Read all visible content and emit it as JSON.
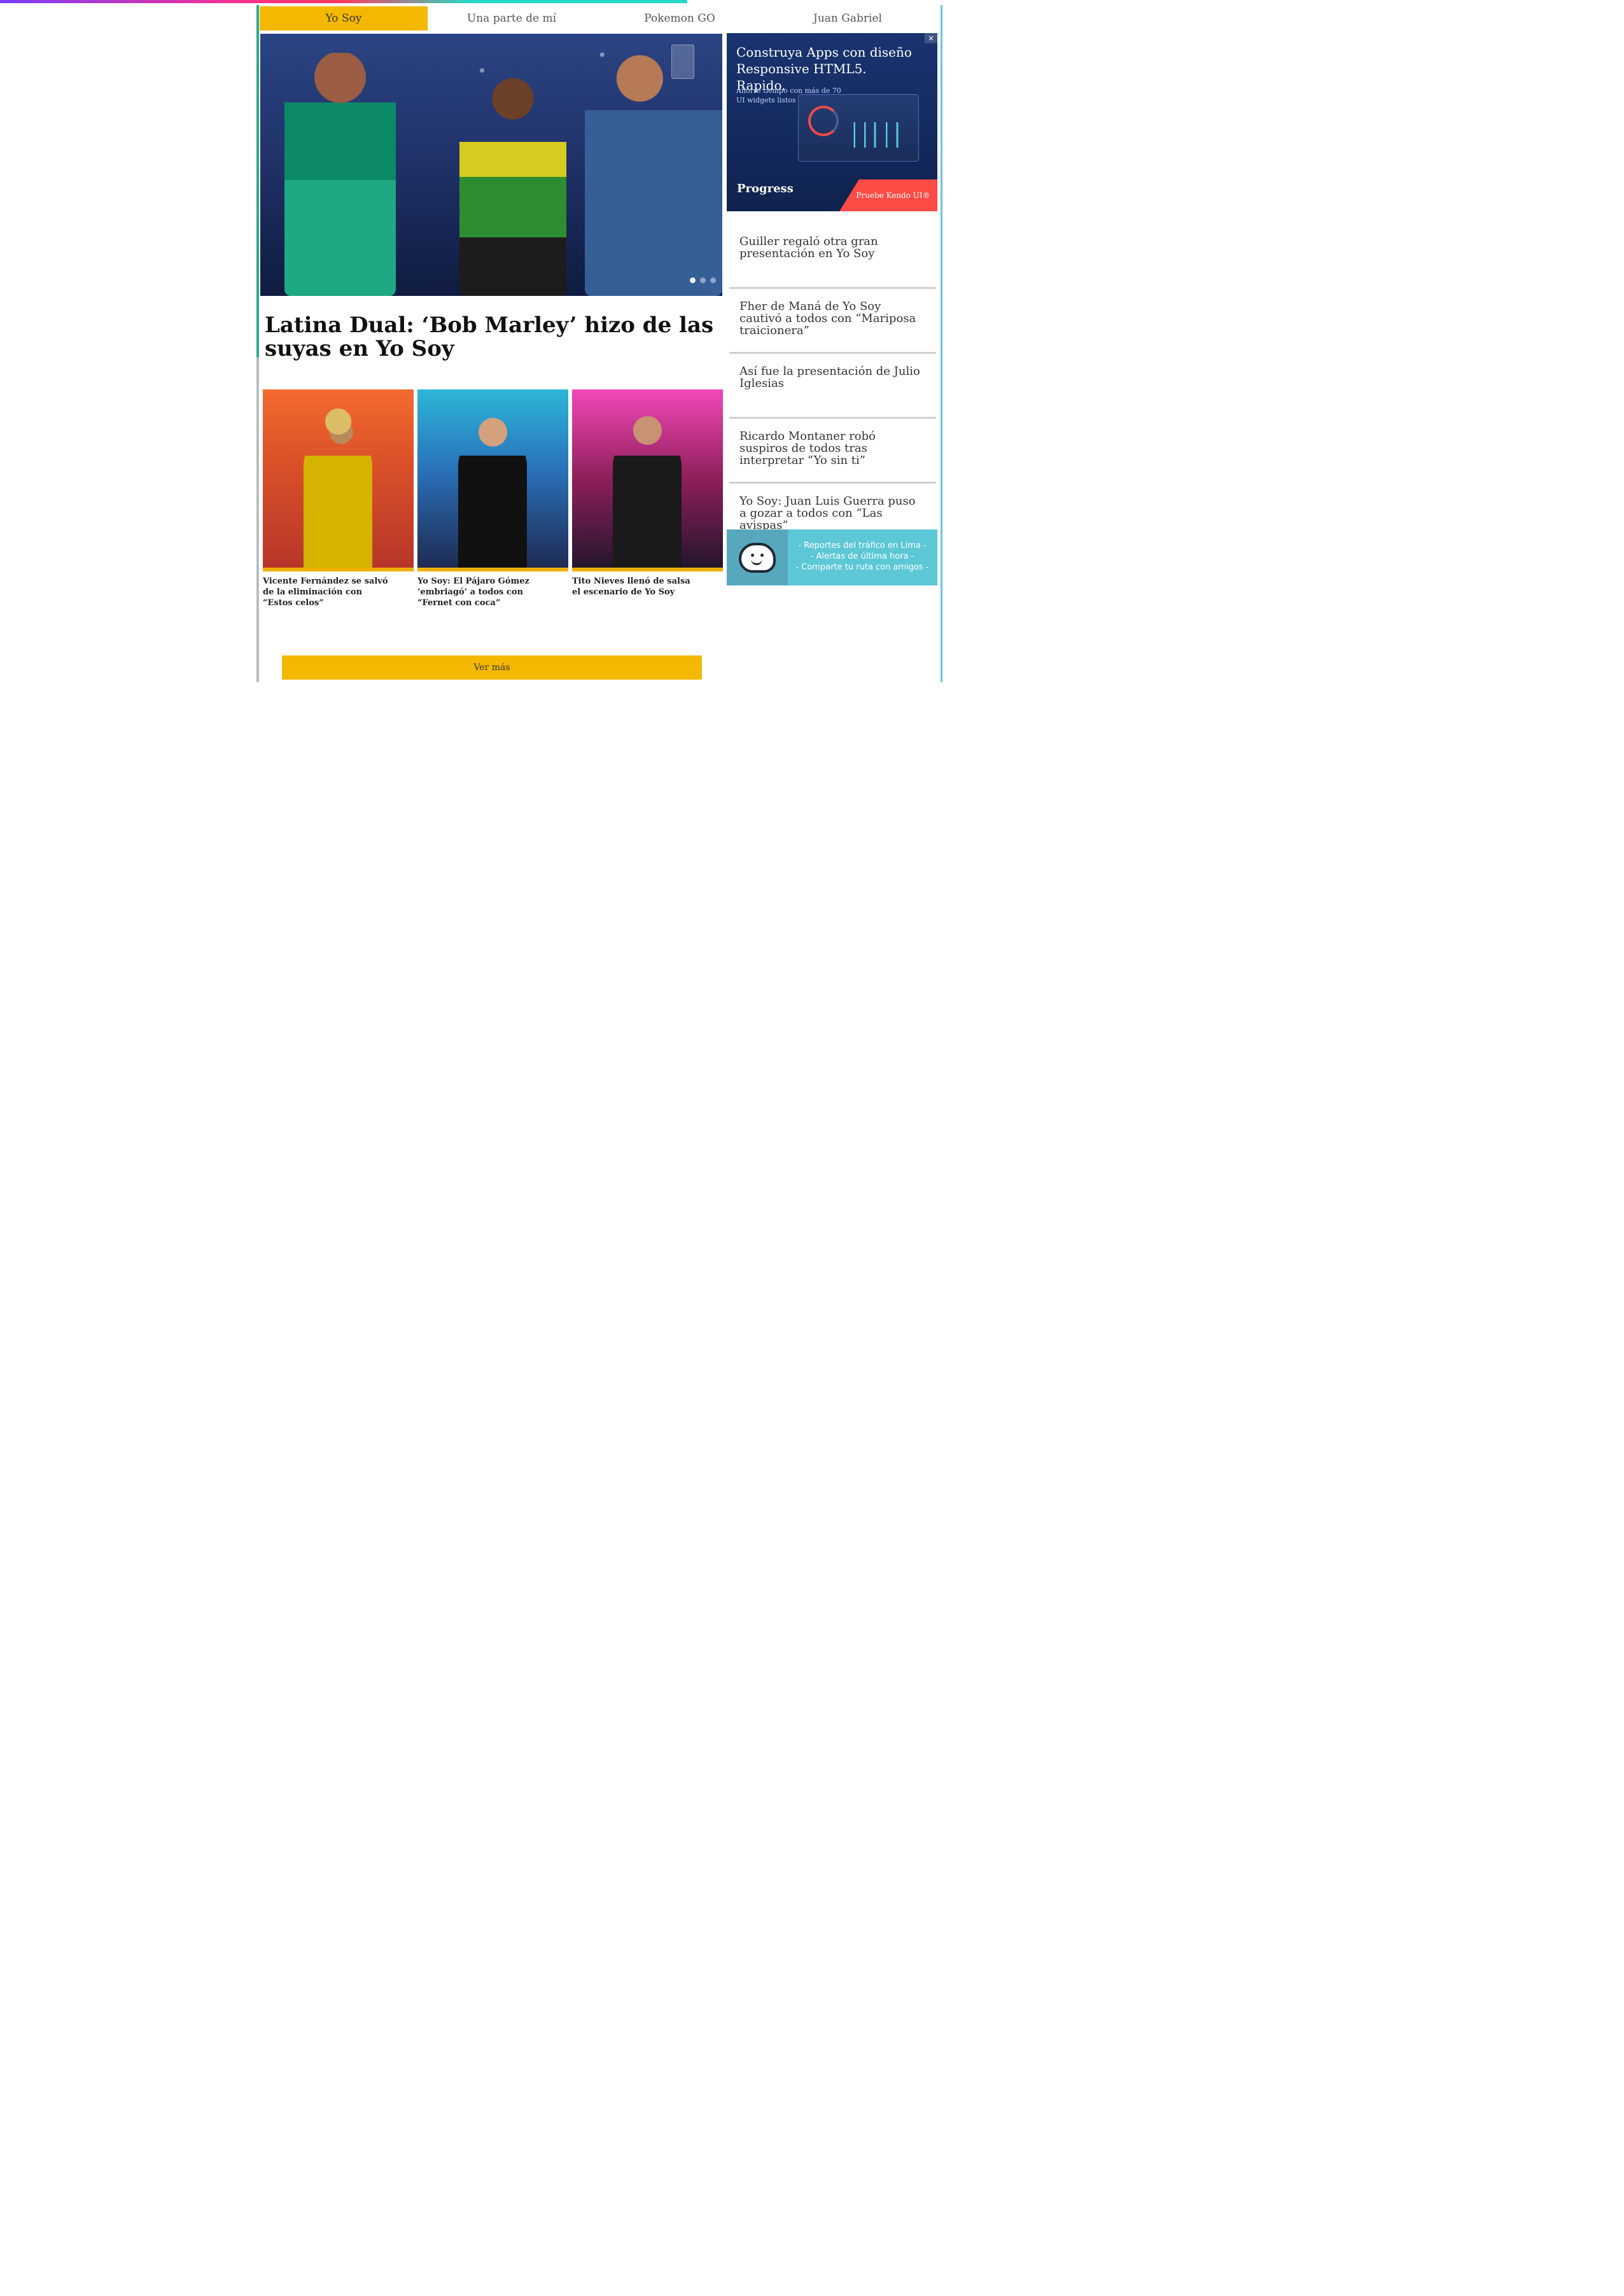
{
  "nav": {
    "tabs": [
      {
        "label": "Yo Soy"
      },
      {
        "label": "Una parte de mí"
      },
      {
        "label": "Pokemon GO"
      },
      {
        "label": "Juan Gabriel"
      }
    ]
  },
  "hero": {
    "headline": "Latina Dual: ‘Bob Marley’ hizo de las suyas en Yo Soy"
  },
  "ad": {
    "title": "Construya Apps con diseño Responsive HTML5. Rapido.",
    "text": "Ahorre tiempo con más de 70 UI widgets listos para usar",
    "logo": "Progress",
    "cta": "Pruebe Kendo UI®",
    "close": "×"
  },
  "sidebar": {
    "items": [
      {
        "label": "Guiller regaló otra gran presentación en Yo Soy"
      },
      {
        "label": "Fher de Maná de Yo Soy cautivó a todos con “Mariposa traicionera”"
      },
      {
        "label": "Así fue la presentación de Julio Iglesias"
      },
      {
        "label": "Ricardo Montaner robó suspiros de todos tras interpretar “Yo sin ti”"
      },
      {
        "label": "Yo Soy: Juan Luis Guerra puso a gozar a todos con “Las avispas”"
      }
    ]
  },
  "waze": {
    "lines": [
      "- Reportes del tráfico en Lima -",
      "- Alertas de última hora -",
      "- Comparte tu ruta con amigos -"
    ]
  },
  "cards": [
    {
      "caption": "Vicente Fernández se salvó de la eliminación con “Estos celos”"
    },
    {
      "caption": "Yo Soy: El Pájaro Gómez ‘embriagó’ a todos con “Fernet con coca”"
    },
    {
      "caption": "Tito Nieves llenó de salsa el escenario de Yo Soy"
    }
  ],
  "more": {
    "label": "Ver más"
  }
}
